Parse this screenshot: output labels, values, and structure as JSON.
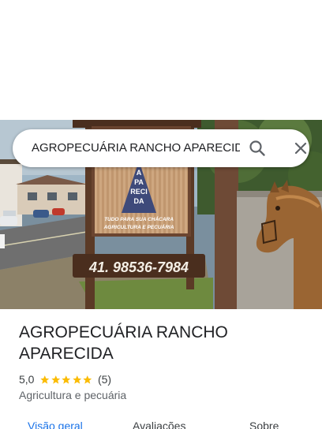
{
  "search": {
    "query": "AGROPECUÁRIA RANCHO APARECIDA"
  },
  "hero": {
    "sign_brand_line1": "A",
    "sign_brand_line2": "PA",
    "sign_brand_line3": "RECI",
    "sign_brand_line4": "DA",
    "sign_slogan_line1": "TUDO PARA SUA CHÁCARA",
    "sign_slogan_line2": "AGRICULTURA E PECUÁRIA",
    "sign_phone": "41. 98536-7984"
  },
  "place": {
    "name_line1": "AGROPECUÁRIA RANCHO",
    "name_line2": "APARECIDA",
    "rating": "5,0",
    "stars": 5,
    "review_count": "(5)",
    "category": "Agricultura e pecuária"
  },
  "tabs": [
    {
      "label": "Visão geral",
      "active": true
    },
    {
      "label": "Avaliações",
      "active": false
    },
    {
      "label": "Sobre",
      "active": false
    }
  ],
  "colors": {
    "accent": "#1a73e8",
    "star": "#fbbc04",
    "text_primary": "#202124",
    "text_secondary": "#5f6368"
  },
  "icons": {
    "search": "search-icon",
    "close": "close-icon",
    "star": "star-icon"
  }
}
